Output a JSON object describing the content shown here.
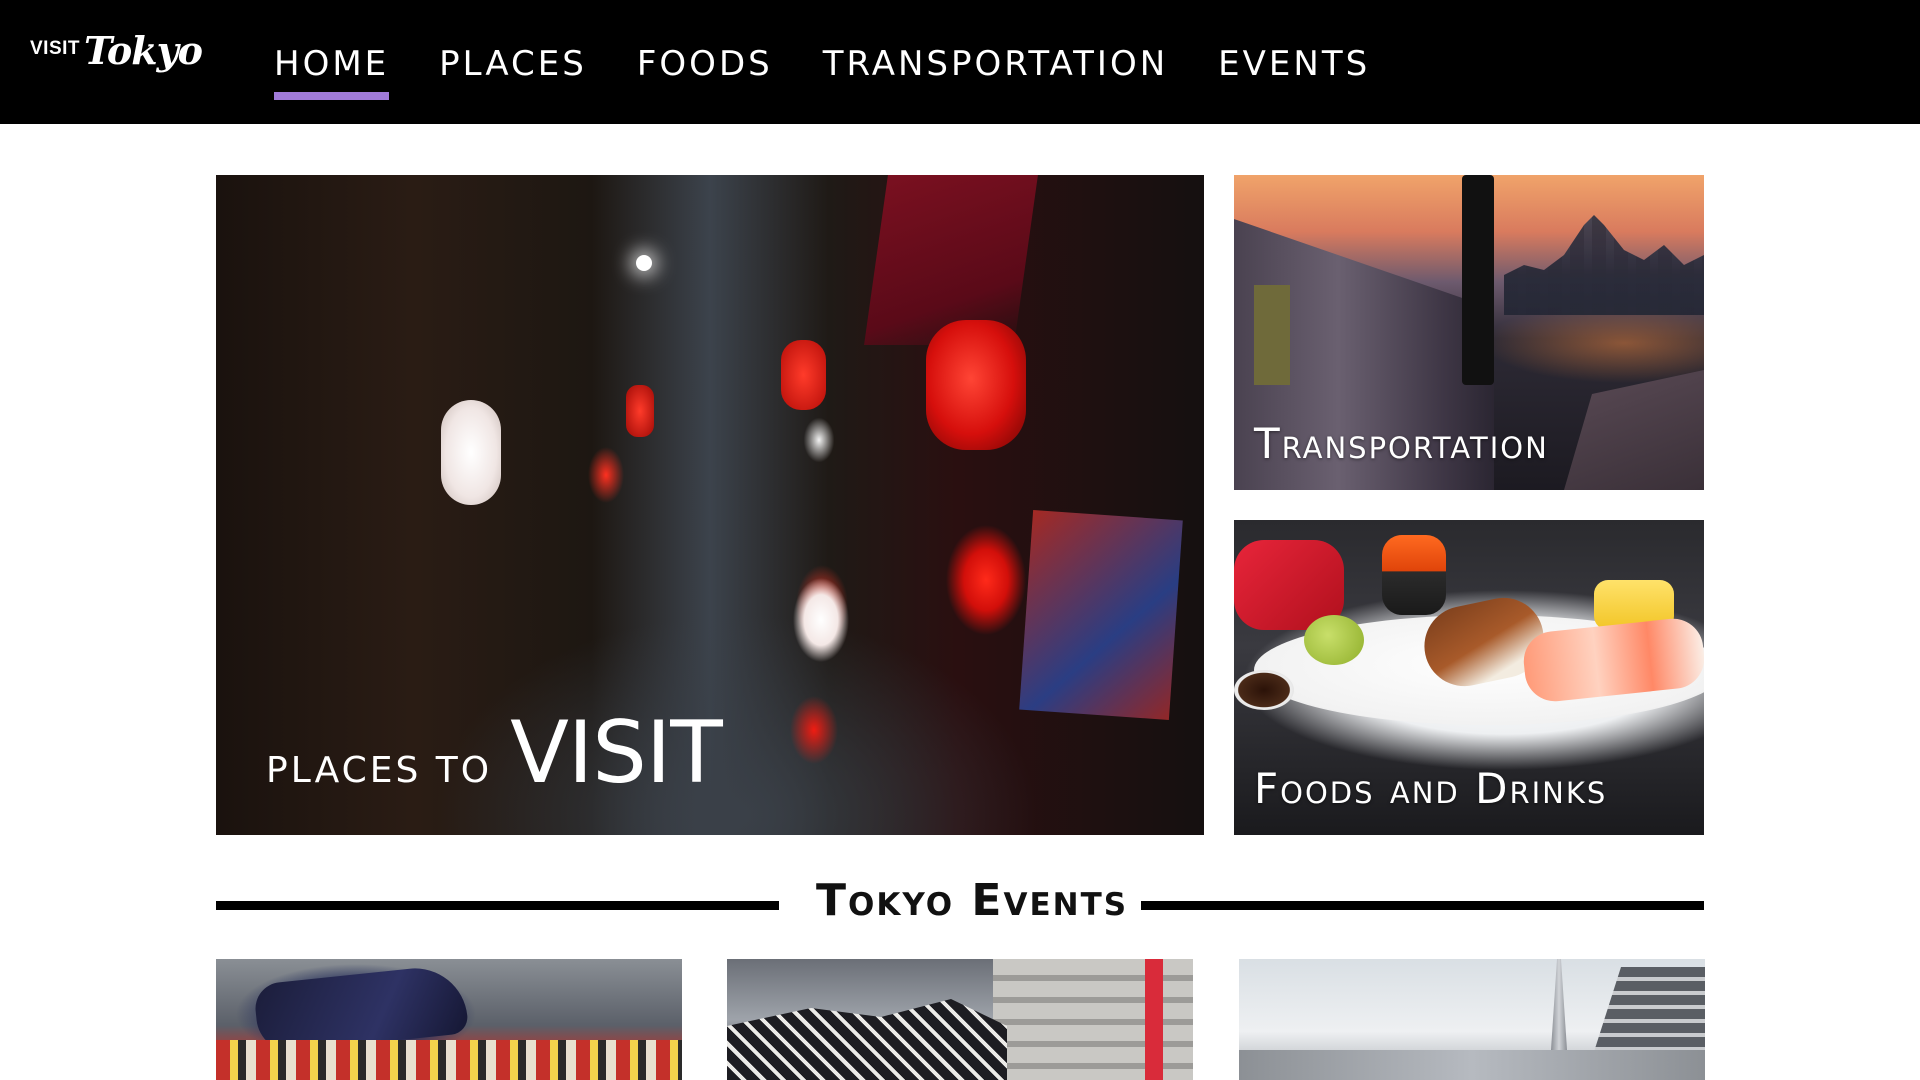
{
  "accent": "#a07ad8",
  "logo": {
    "visit": "VISIT",
    "tokyo": "Tokyo"
  },
  "nav": [
    {
      "label": "HOME",
      "active": true
    },
    {
      "label": "PLACES",
      "active": false
    },
    {
      "label": "FOODS",
      "active": false
    },
    {
      "label": "TRANSPORTATION",
      "active": false
    },
    {
      "label": "EVENTS",
      "active": false
    }
  ],
  "hero": {
    "places": {
      "small": "PLACES TO",
      "big": "VISIT"
    },
    "transportation": {
      "label": "Transportation"
    },
    "foods": {
      "label": "Foods and Drinks"
    }
  },
  "events": {
    "title": "Tokyo Events"
  }
}
